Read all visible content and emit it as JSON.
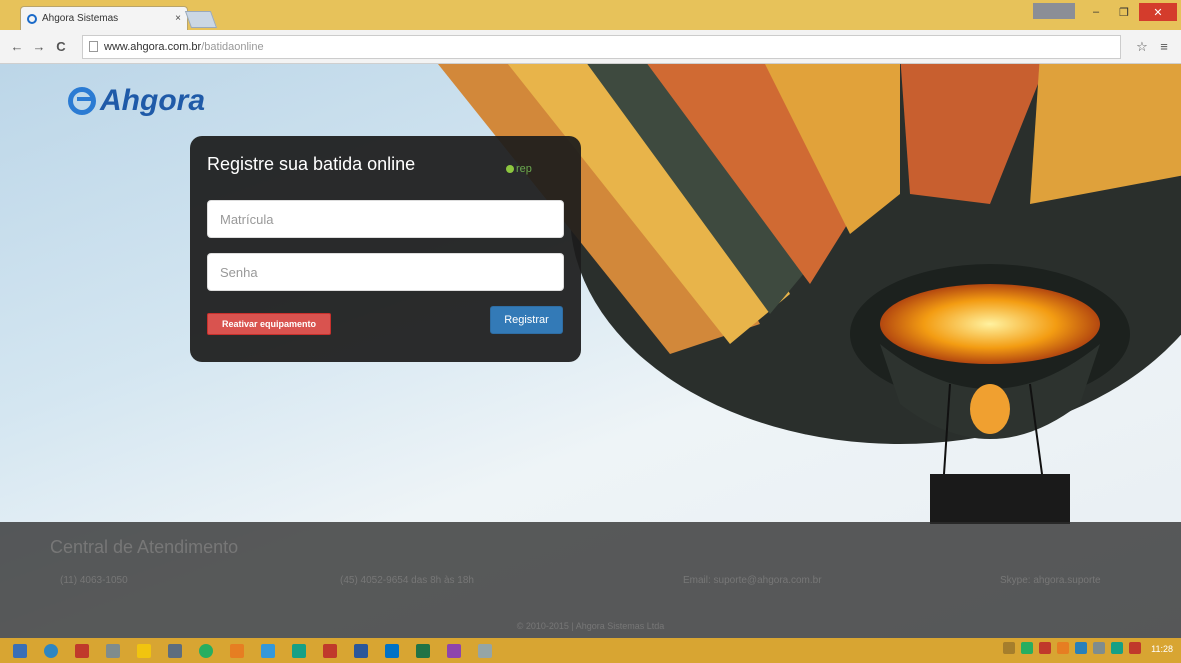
{
  "browser": {
    "tab_title": "Ahgora Sistemas",
    "tab_close": "×",
    "url_domain": "www.ahgora.com.br",
    "url_path": "/batidaonline",
    "back": "←",
    "forward": "→",
    "reload": "C",
    "star": "☆",
    "menu": "≡",
    "minimize": "–",
    "restore": "❐",
    "close": "✕"
  },
  "page": {
    "logo_text": "Ahgora",
    "form": {
      "title": "Registre sua batida online",
      "rep_label": "rep",
      "matricula_placeholder": "Matrícula",
      "senha_placeholder": "Senha",
      "reactivate_label": "Reativar equipamento",
      "register_label": "Registrar"
    },
    "footer": {
      "title": "Central de Atendimento",
      "phone1": "(11) 4063-1050",
      "phone2": "(45) 4052-9654 das 8h às 18h",
      "email": "Email: suporte@ahgora.com.br",
      "skype": "Skype: ahgora.suporte",
      "copyright": "© 2010-2015 | Ahgora Sistemas Ltda"
    }
  },
  "taskbar": {
    "clock": "11:28",
    "accent": "#d8a532"
  },
  "colors": {
    "title_bar": "#e7c25a",
    "panel": "#1c1c1c",
    "button_red": "#d9534f",
    "button_blue": "#337ab7",
    "logo": "#1f5aa8"
  }
}
